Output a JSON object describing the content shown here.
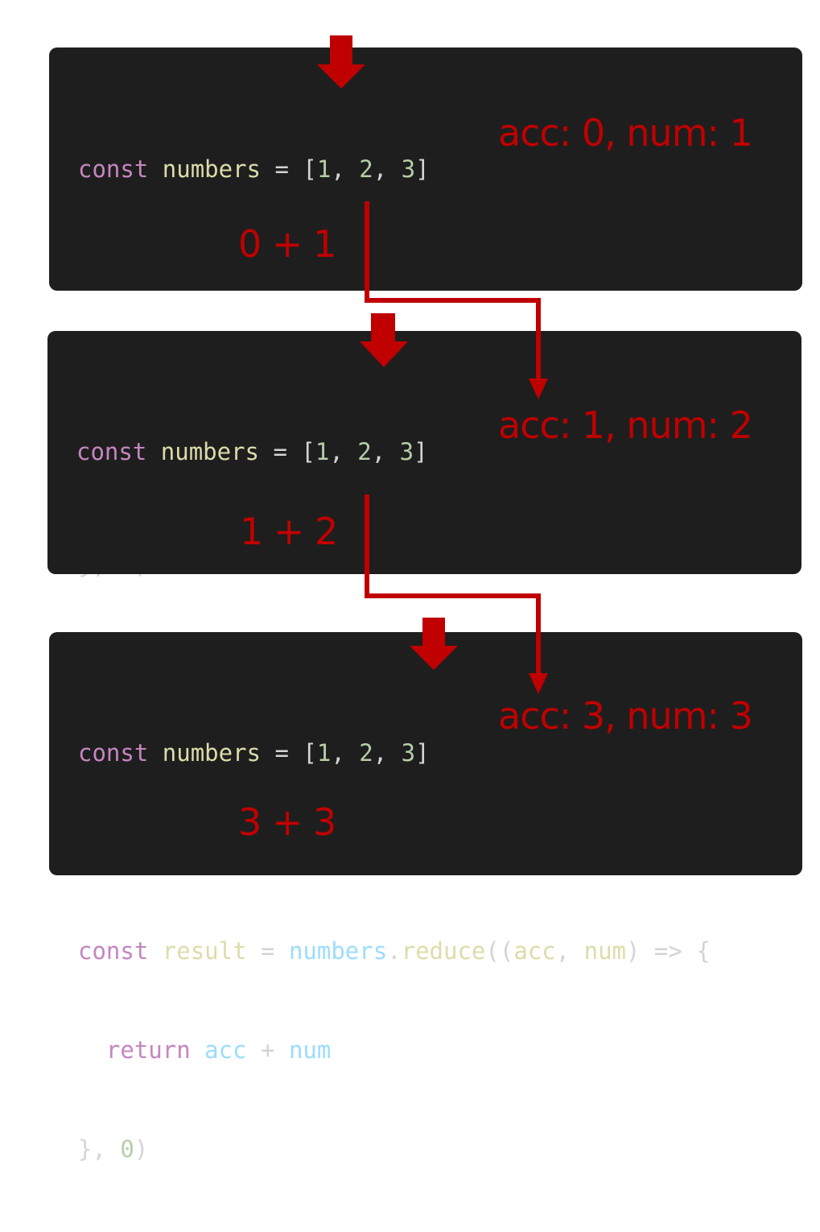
{
  "colors": {
    "panel_bg": "#1e1e1e",
    "keyword": "#c586c0",
    "declared_name": "#dcdcaa",
    "identifier": "#9cdcfe",
    "number": "#b5cea8",
    "punctuation": "#d4d4d4",
    "annotation": "#c00000"
  },
  "code": {
    "kw_const": "const",
    "kw_return": "return",
    "numbers": "numbers",
    "result": "result",
    "reduce": "reduce",
    "acc": "acc",
    "num": "num",
    "eq": " = ",
    "open_bracket": "[",
    "close_bracket": "]",
    "comma_space": ", ",
    "n1": "1",
    "n2": "2",
    "n3": "3",
    "dot": ".",
    "open_call": "((",
    "arrow_open": ") => {",
    "plus": " + ",
    "close_call": "}, ",
    "zero": "0",
    "close_paren": ")",
    "indent": "  ",
    "space": " "
  },
  "steps": [
    {
      "state": "acc: 0, num: 1",
      "sum": "0 + 1"
    },
    {
      "state": "acc: 1, num: 2",
      "sum": "1 + 2"
    },
    {
      "state": "acc: 3, num: 3",
      "sum": "3 + 3"
    }
  ],
  "icons": [
    "down-arrow-icon",
    "flow-connector"
  ]
}
